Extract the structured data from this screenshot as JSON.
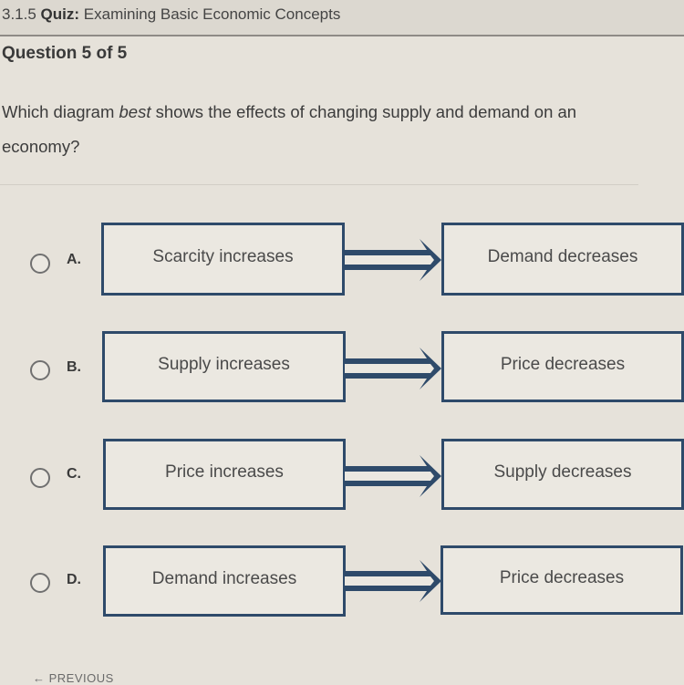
{
  "header": {
    "section": "3.1.5",
    "type_label": "Quiz:",
    "title": "Examining Basic Economic Concepts"
  },
  "question": {
    "counter": "Question 5 of 5",
    "prompt_before": "Which diagram ",
    "prompt_emphasis": "best",
    "prompt_after": " shows the effects of changing supply and demand on an economy?"
  },
  "options": [
    {
      "letter": "A.",
      "cause": "Scarcity increases",
      "effect": "Demand decreases",
      "selected": false
    },
    {
      "letter": "B.",
      "cause": "Supply increases",
      "effect": "Price decreases",
      "selected": false
    },
    {
      "letter": "C.",
      "cause": "Price increases",
      "effect": "Supply decreases",
      "selected": false
    },
    {
      "letter": "D.",
      "cause": "Demand increases",
      "effect": "Price decreases",
      "selected": false
    }
  ],
  "arrow_icon": "double-line-right-arrow",
  "footer": {
    "previous_icon": "left-arrow",
    "previous_label": "PREVIOUS"
  },
  "colors": {
    "box_border": "#2e4a6a",
    "background": "#e6e2da"
  }
}
